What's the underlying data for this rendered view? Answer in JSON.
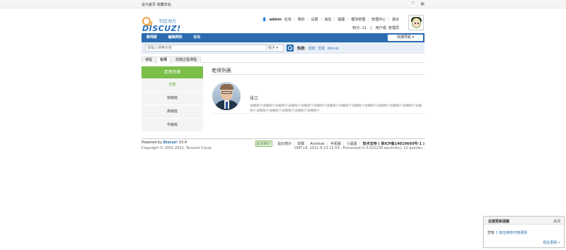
{
  "topbar": {
    "links": [
      "设为首页",
      "收藏本站"
    ],
    "icons": [
      "expand-icon",
      "skin-icon"
    ]
  },
  "brand": {
    "logo_cn": "社区动力",
    "logo_en": "DISCUZ!"
  },
  "user": {
    "name": "admin",
    "links": [
      "在线",
      "我的",
      "设置",
      "消息",
      "提醒",
      "模块管理",
      "管理中心",
      "退出"
    ],
    "credits_label": "积分: 11",
    "group_label": "用户组: 管理员"
  },
  "nav": {
    "items": [
      "教师群",
      "编辑网校",
      "论坛"
    ],
    "quick_nav": "快捷导航"
  },
  "search": {
    "placeholder": "请输入搜索内容",
    "type": "帖子",
    "hot_label": "热搜:",
    "hot_terms": [
      "活动",
      "交友",
      "discuz"
    ]
  },
  "tabs": [
    "课程",
    "名师",
    "前端过程课程"
  ],
  "sidebar": {
    "title": "老师列表",
    "items": [
      "全部",
      "初级班",
      "高级班",
      "中级班"
    ]
  },
  "main": {
    "title": "老师列表",
    "teacher": {
      "name": "张三",
      "desc": "详细简介详细简介详细简介详细简介详细简介详细简介详细简介详细简介详细简介详细简介详细简介详细简介详细简介详细简介详细简介详细简介详细简介详细简介详细简介"
    }
  },
  "footer": {
    "powered": "Powered by",
    "powered_brand": "Discuz!",
    "version": "X3.4",
    "copyright": "Copyright © 2001-2021, Tencent Cloud.",
    "right_links": [
      "站长统计",
      "举报",
      "Archiver",
      "手机版",
      "小黑屋"
    ],
    "badge": "站长统计",
    "support": "技术支持 ( 某ICP备14019660号-1 )",
    "stats": "GMT+8, 2021-8-23 12:59 , Processed in 0.022239 second(s), 12 queries ."
  },
  "popup": {
    "title": "近期更新提醒",
    "close": "关闭",
    "body_prefix": "您有",
    "body_link": "1 条应用有可用更新",
    "more": "现在更新 »"
  }
}
